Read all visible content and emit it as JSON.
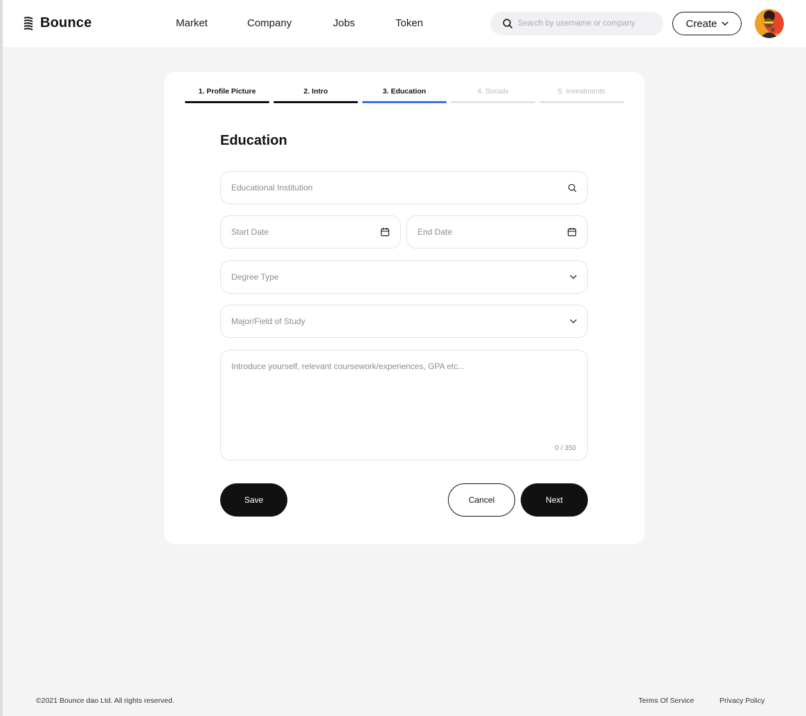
{
  "header": {
    "brand": "Bounce",
    "nav": [
      "Market",
      "Company",
      "Jobs",
      "Token"
    ],
    "search_placeholder": "Search by username or company",
    "create_label": "Create"
  },
  "steps": [
    {
      "label": "1. Profile Picture",
      "state": "done"
    },
    {
      "label": "2. Intro",
      "state": "done"
    },
    {
      "label": "3. Education",
      "state": "active"
    },
    {
      "label": "4. Socials",
      "state": "pending"
    },
    {
      "label": "5. Investments",
      "state": "pending"
    }
  ],
  "form": {
    "title": "Education",
    "institution_placeholder": "Educational Institution",
    "start_date_placeholder": "Start Date",
    "end_date_placeholder": "End Date",
    "degree_placeholder": "Degree Type",
    "major_placeholder": "Major/Field of Study",
    "intro_placeholder": "Introduce yourself, relevant coursework/experiences, GPA etc...",
    "counter": "0 / 350",
    "save_label": "Save",
    "cancel_label": "Cancel",
    "next_label": "Next"
  },
  "footer": {
    "copyright": "©2021 Bounce dao Ltd. All rights reserved.",
    "terms": "Terms Of Service",
    "privacy": "Privacy Policy"
  },
  "colors": {
    "accent": "#3a6ef5",
    "dark": "#111111",
    "background": "#f4f4f4"
  },
  "icons": [
    "bounce-logo-icon",
    "search-icon",
    "chevron-down-icon",
    "calendar-icon",
    "avatar"
  ]
}
